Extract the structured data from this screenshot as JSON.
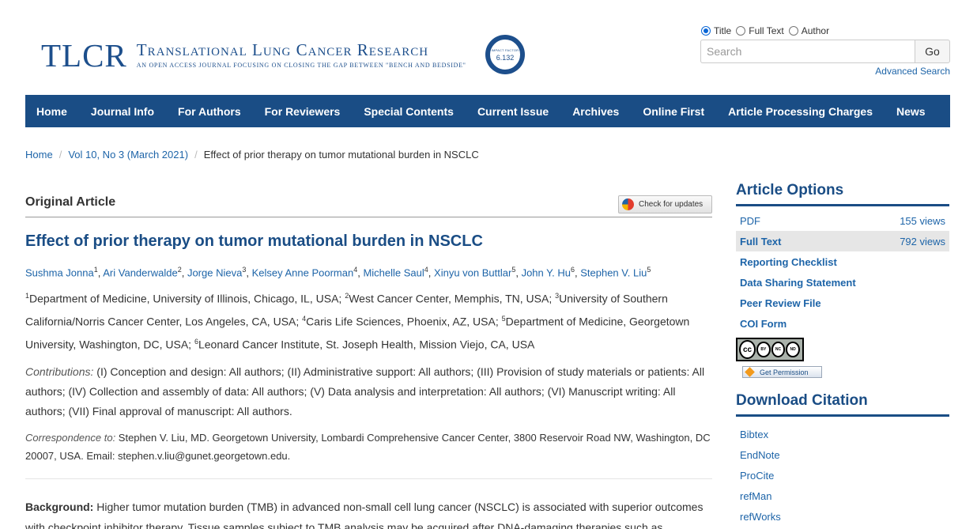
{
  "header": {
    "logo_abbr": "TLCR",
    "logo_name": "Translational Lung Cancer Research",
    "logo_tagline": "An open access journal focusing on closing the gap between \"bench and bedside\"",
    "impact_label": "IMPACT FACTOR",
    "impact_factor": "6.132"
  },
  "search": {
    "options": [
      {
        "label": "Title",
        "checked": true
      },
      {
        "label": "Full Text",
        "checked": false
      },
      {
        "label": "Author",
        "checked": false
      }
    ],
    "placeholder": "Search",
    "go_label": "Go",
    "advanced_label": "Advanced Search"
  },
  "nav": {
    "items": [
      "Home",
      "Journal Info",
      "For Authors",
      "For Reviewers",
      "Special Contents",
      "Current Issue",
      "Archives",
      "Online First",
      "Article Processing Charges",
      "News"
    ]
  },
  "breadcrumb": {
    "home": "Home",
    "issue": "Vol 10, No 3 (March 2021)",
    "sep": "/",
    "current": "Effect of prior therapy on tumor mutational burden in NSCLC"
  },
  "article": {
    "type": "Original Article",
    "check_updates": "Check for updates",
    "title": "Effect of prior therapy on tumor mutational burden in NSCLC",
    "authors": [
      {
        "name": "Sushma Jonna",
        "sup": "1"
      },
      {
        "name": "Ari Vanderwalde",
        "sup": "2"
      },
      {
        "name": "Jorge Nieva",
        "sup": "3"
      },
      {
        "name": "Kelsey Anne Poorman",
        "sup": "4"
      },
      {
        "name": "Michelle Saul",
        "sup": "4"
      },
      {
        "name": "Xinyu von Buttlar",
        "sup": "5"
      },
      {
        "name": "John Y. Hu",
        "sup": "6"
      },
      {
        "name": "Stephen V. Liu",
        "sup": "5"
      }
    ],
    "author_sep": ", ",
    "affiliations": [
      {
        "sup": "1",
        "text": "Department of Medicine, University of Illinois, Chicago, IL, USA; "
      },
      {
        "sup": "2",
        "text": "West Cancer Center, Memphis, TN, USA; "
      },
      {
        "sup": "3",
        "text": "University of Southern California/Norris Cancer Center, Los Angeles, CA, USA; "
      },
      {
        "sup": "4",
        "text": "Caris Life Sciences, Phoenix, AZ, USA; "
      },
      {
        "sup": "5",
        "text": "Department of Medicine, Georgetown University, Washington, DC, USA; "
      },
      {
        "sup": "6",
        "text": "Leonard Cancer Institute, St. Joseph Health, Mission Viejo, CA, USA"
      }
    ],
    "contributions_label": "Contributions:",
    "contributions_text": " (I) Conception and design: All authors; (II) Administrative support: All authors; (III) Provision of study materials or patients: All authors; (IV) Collection and assembly of data: All authors; (V) Data analysis and interpretation: All authors; (VI) Manuscript writing: All authors; (VII) Final approval of manuscript: All authors.",
    "correspondence_label": "Correspondence to:",
    "correspondence_text": " Stephen V. Liu, MD. Georgetown University, Lombardi Comprehensive Cancer Center, 3800 Reservoir Road NW, Washington, DC 20007, USA. Email: stephen.v.liu@gunet.georgetown.edu.",
    "background_label": "Background:",
    "background_text": " Higher tumor mutation burden (TMB) in advanced non-small cell lung cancer (NSCLC) is associated with superior outcomes with checkpoint inhibitor therapy. Tissue samples subject to TMB analysis may be acquired after DNA-damaging therapies such as"
  },
  "sidebar": {
    "options_heading": "Article Options",
    "options": [
      {
        "label": "PDF",
        "views": "155 views",
        "bold": false,
        "active": false
      },
      {
        "label": "Full Text",
        "views": "792 views",
        "bold": true,
        "active": true
      },
      {
        "label": "Reporting Checklist",
        "views": "",
        "bold": true,
        "active": false
      },
      {
        "label": "Data Sharing Statement",
        "views": "",
        "bold": true,
        "active": false
      },
      {
        "label": "Peer Review File",
        "views": "",
        "bold": true,
        "active": false
      },
      {
        "label": "COI Form",
        "views": "",
        "bold": true,
        "active": false
      }
    ],
    "license": {
      "cc": "cc",
      "by": "BY",
      "nc": "NC",
      "nd": "ND"
    },
    "permission_label": "Get Permission",
    "citation_heading": "Download Citation",
    "citations": [
      "Bibtex",
      "EndNote",
      "ProCite",
      "refMan",
      "refWorks"
    ]
  }
}
